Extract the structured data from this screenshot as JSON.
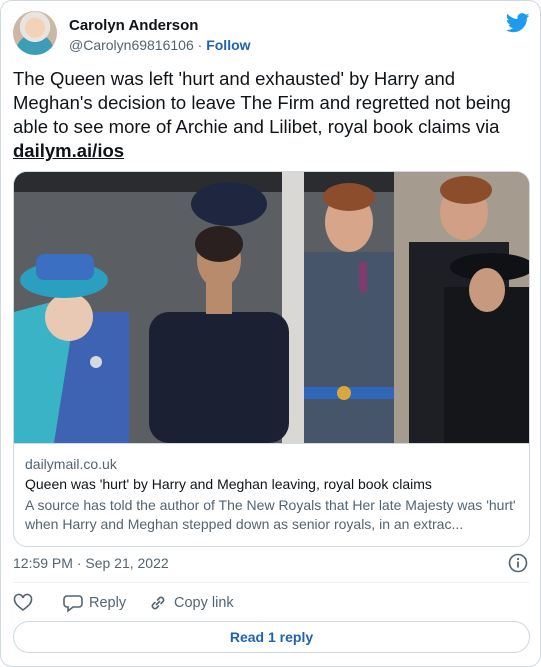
{
  "user": {
    "display_name": "Carolyn Anderson",
    "handle": "@Carolyn69816106",
    "separator": "·",
    "follow_label": "Follow"
  },
  "tweet": {
    "text": "The Queen was left 'hurt and exhausted' by Harry and Meghan's decision to leave The Firm and regretted not being able to see more of Archie and Lilibet, royal book claims via ",
    "link_text": "dailym.ai/ios"
  },
  "link_card": {
    "domain": "dailymail.co.uk",
    "title": "Queen was 'hurt' by Harry and Meghan leaving, royal book claims",
    "description": "A source has told the author of The New Royals that Her late Majesty was 'hurt' when Harry and Meghan stepped down as senior royals, in an extrac..."
  },
  "meta": {
    "timestamp": "12:59 PM · Sep 21, 2022"
  },
  "actions": {
    "reply_label": "Reply",
    "copy_link_label": "Copy link"
  },
  "read_replies_label": "Read 1 reply",
  "colors": {
    "accent": "#1d62b8",
    "bird": "#1d9bf0",
    "muted": "#536471",
    "border": "#cfd9de"
  },
  "icons": [
    "twitter-bird-icon",
    "info-icon",
    "heart-icon",
    "reply-icon",
    "link-icon"
  ]
}
